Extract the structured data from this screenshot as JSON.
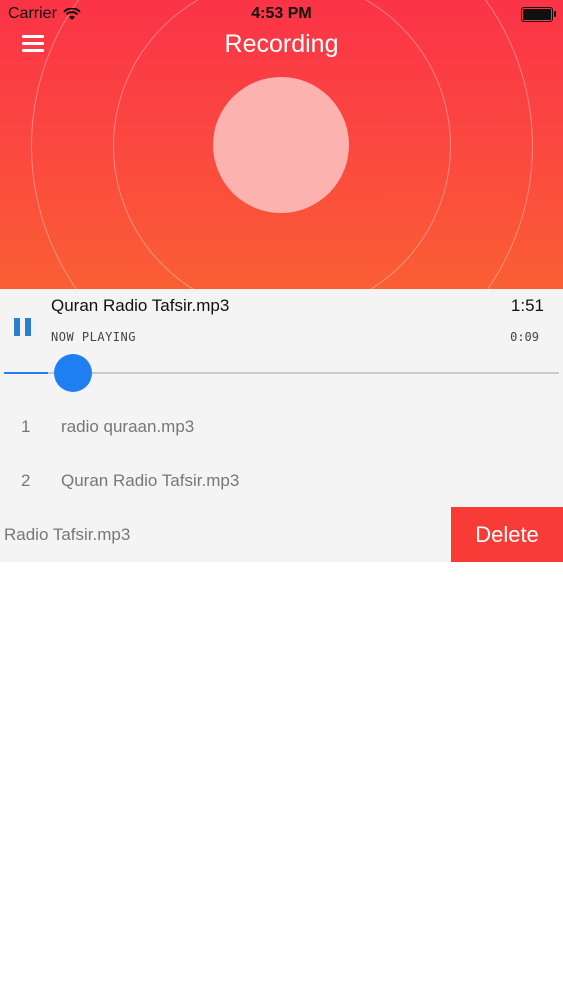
{
  "status_bar": {
    "carrier": "Carrier",
    "time": "4:53 PM",
    "wifi_icon": "wifi-icon",
    "battery_icon": "battery-icon"
  },
  "header": {
    "title": "Recording",
    "menu_icon": "hamburger-menu-icon"
  },
  "player": {
    "track_title": "Quran Radio Tafsir.mp3",
    "duration": "1:51",
    "status_text": "NOW PLAYING",
    "elapsed": "0:09",
    "progress_fraction": 0.08,
    "accent_color": "#1f7ef2"
  },
  "playlist": [
    {
      "index": "1",
      "name": "radio quraan.mp3"
    },
    {
      "index": "2",
      "name": "Quran Radio Tafsir.mp3"
    }
  ],
  "swiped_row": {
    "name": "Radio Tafsir.mp3",
    "delete_label": "Delete",
    "delete_color": "#f83b37"
  }
}
